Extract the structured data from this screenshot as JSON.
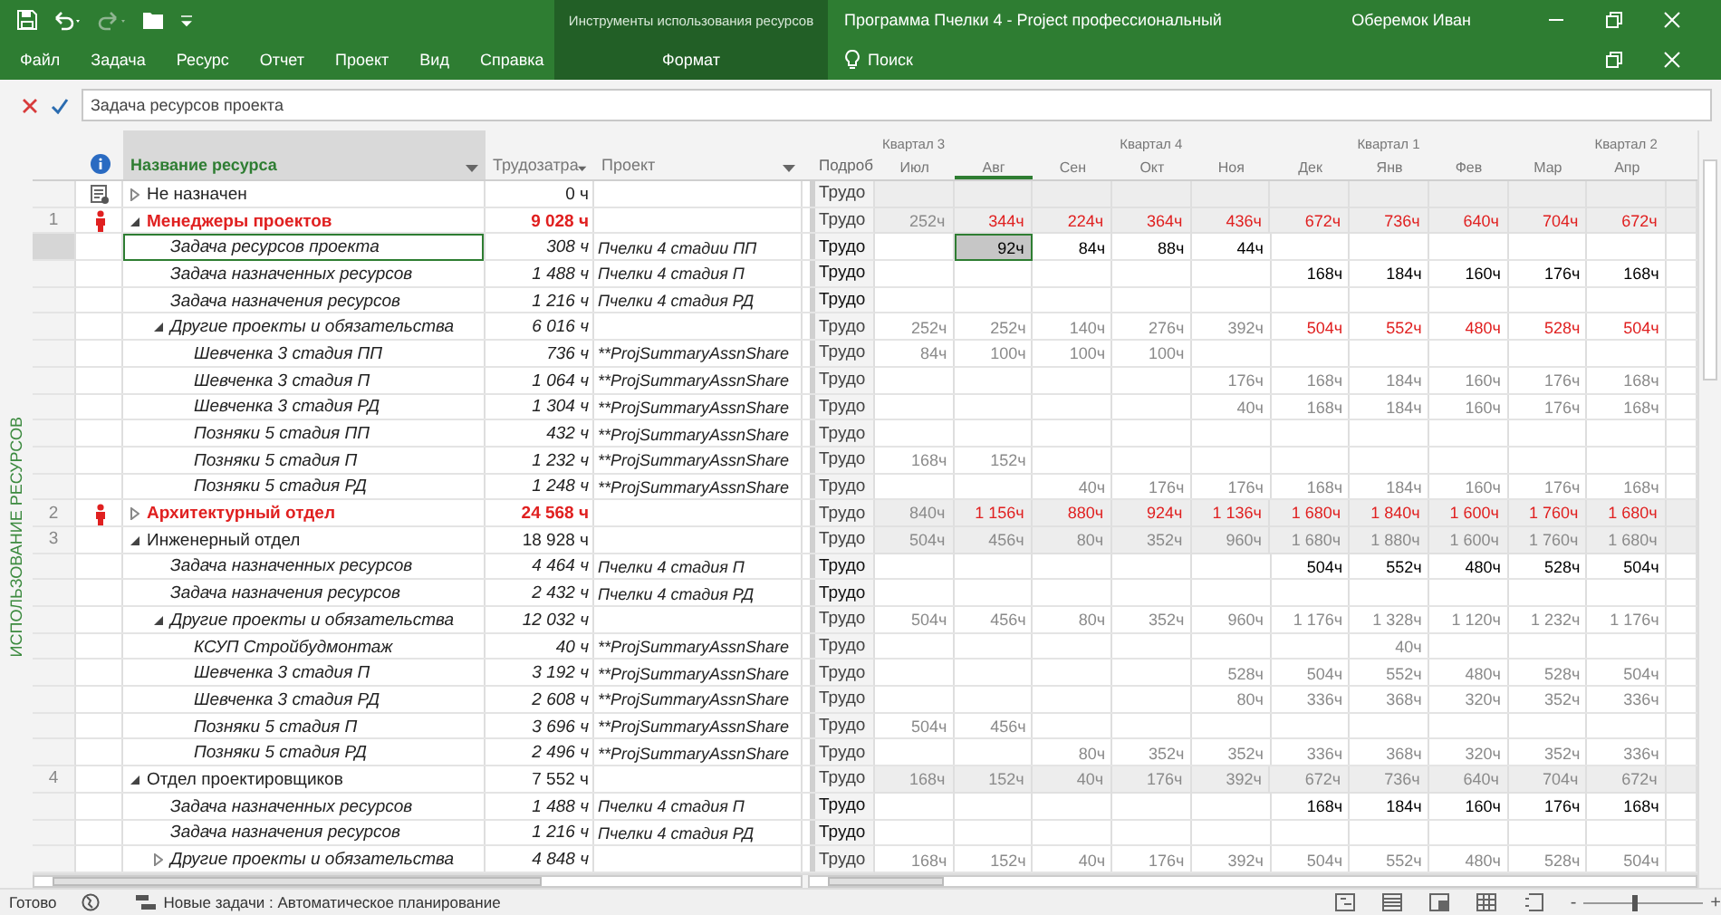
{
  "title_bar": {
    "contextual_group": "Инструменты использования ресурсов",
    "title": "Программа Пчелки 4  -  Project профессиональный",
    "user": "Оберемок Иван"
  },
  "ribbon_tabs": [
    {
      "label": "Файл",
      "contextual": false
    },
    {
      "label": "Задача",
      "contextual": false
    },
    {
      "label": "Ресурс",
      "contextual": false
    },
    {
      "label": "Отчет",
      "contextual": false
    },
    {
      "label": "Проект",
      "contextual": false
    },
    {
      "label": "Вид",
      "contextual": false
    },
    {
      "label": "Справка",
      "contextual": false
    },
    {
      "label": "Формат",
      "contextual": true
    }
  ],
  "search": "Поиск",
  "formula_bar": {
    "value": "Задача ресурсов проекта"
  },
  "view_label": "ИСПОЛЬЗОВАНИЕ РЕСУРСОВ",
  "columns": [
    {
      "label": "Название ресурса",
      "selected": true
    },
    {
      "label": "Трудозатра",
      "selected": false
    },
    {
      "label": "Проект",
      "selected": false
    }
  ],
  "timescale": {
    "detail_header": "Подроб",
    "quarters": [
      {
        "label": "Квартал 3",
        "months": [
          {
            "label": "Июл",
            "selected": false
          },
          {
            "label": "Авг",
            "selected": true
          },
          {
            "label": "Сен",
            "selected": false
          }
        ]
      },
      {
        "label": "Квартал 4",
        "months": [
          {
            "label": "Окт",
            "selected": false
          },
          {
            "label": "Ноя",
            "selected": false
          },
          {
            "label": "Дек",
            "selected": false
          }
        ]
      },
      {
        "label": "Квартал 1",
        "months": [
          {
            "label": "Янв",
            "selected": false
          },
          {
            "label": "Фев",
            "selected": false
          },
          {
            "label": "Мар",
            "selected": false
          }
        ]
      },
      {
        "label": "Квартал 2",
        "months": [
          {
            "label": "Апр",
            "selected": false
          }
        ]
      }
    ]
  },
  "resources": [
    {
      "kind": "unassigned",
      "name": "Не назначен",
      "work": "0 ч",
      "overallocated": false,
      "expanded": false,
      "selected": false,
      "detail": "Трудо",
      "cells": [
        null,
        null,
        null,
        null,
        null,
        null,
        null,
        null,
        null,
        null
      ]
    },
    {
      "number": "1",
      "kind": "resource",
      "name": "Менеджеры проектов",
      "work": "9 028 ч",
      "overallocated": true,
      "expanded": true,
      "selected": false,
      "detail": "Трудо",
      "cells": [
        {
          "text": "252ч",
          "overallocated": false
        },
        {
          "text": "344ч",
          "overallocated": true
        },
        {
          "text": "224ч",
          "overallocated": true
        },
        {
          "text": "364ч",
          "overallocated": true
        },
        {
          "text": "436ч",
          "overallocated": true
        },
        {
          "text": "672ч",
          "overallocated": true
        },
        {
          "text": "736ч",
          "overallocated": true
        },
        {
          "text": "640ч",
          "overallocated": true
        },
        {
          "text": "704ч",
          "overallocated": true
        },
        {
          "text": "672ч",
          "overallocated": true
        }
      ],
      "children": [
        {
          "name": "Задача ресурсов проекта",
          "work": "308 ч",
          "project": "Пчелки 4 стадии ПП",
          "editable": true,
          "selected": true,
          "detail": "Трудо",
          "cells": [
            null,
            {
              "text": "92ч",
              "overallocated": false
            },
            {
              "text": "84ч",
              "overallocated": false
            },
            {
              "text": "88ч",
              "overallocated": false
            },
            {
              "text": "44ч",
              "overallocated": false
            },
            null,
            null,
            null,
            null,
            null
          ]
        },
        {
          "name": "Задача назначенных ресурсов",
          "work": "1 488 ч",
          "project": "Пчелки 4 стадия П",
          "editable": true,
          "selected": false,
          "detail": "Трудо",
          "cells": [
            null,
            null,
            null,
            null,
            null,
            {
              "text": "168ч",
              "overallocated": false
            },
            {
              "text": "184ч",
              "overallocated": false
            },
            {
              "text": "160ч",
              "overallocated": false
            },
            {
              "text": "176ч",
              "overallocated": false
            },
            {
              "text": "168ч",
              "overallocated": false
            }
          ]
        },
        {
          "name": "Задача назначения ресурсов",
          "work": "1 216 ч",
          "project": "Пчелки 4 стадия РД",
          "editable": true,
          "selected": false,
          "detail": "Трудо",
          "cells": [
            null,
            null,
            null,
            null,
            null,
            null,
            null,
            null,
            null,
            null
          ]
        },
        {
          "name": "Другие проекты и обязательства",
          "work": "6 016 ч",
          "expanded": true,
          "editable": false,
          "selected": false,
          "detail": "Трудо",
          "cells": [
            {
              "text": "252ч",
              "overallocated": false
            },
            {
              "text": "252ч",
              "overallocated": false
            },
            {
              "text": "140ч",
              "overallocated": false
            },
            {
              "text": "276ч",
              "overallocated": false
            },
            {
              "text": "392ч",
              "overallocated": false
            },
            {
              "text": "504ч",
              "overallocated": true
            },
            {
              "text": "552ч",
              "overallocated": true
            },
            {
              "text": "480ч",
              "overallocated": true
            },
            {
              "text": "528ч",
              "overallocated": true
            },
            {
              "text": "504ч",
              "overallocated": true
            }
          ],
          "children": [
            {
              "name": "Шевченка 3 стадия ПП",
              "work": "736 ч",
              "project": "**ProjSummaryAssnShare",
              "editable": false,
              "selected": false,
              "detail": "Трудо",
              "cells": [
                {
                  "text": "84ч",
                  "overallocated": false
                },
                {
                  "text": "100ч",
                  "overallocated": false
                },
                {
                  "text": "100ч",
                  "overallocated": false
                },
                {
                  "text": "100ч",
                  "overallocated": false
                },
                null,
                null,
                null,
                null,
                null,
                null
              ]
            },
            {
              "name": "Шевченка 3 стадия П",
              "work": "1 064 ч",
              "project": "**ProjSummaryAssnShare",
              "editable": false,
              "selected": false,
              "detail": "Трудо",
              "cells": [
                null,
                null,
                null,
                null,
                {
                  "text": "176ч",
                  "overallocated": false
                },
                {
                  "text": "168ч",
                  "overallocated": false
                },
                {
                  "text": "184ч",
                  "overallocated": false
                },
                {
                  "text": "160ч",
                  "overallocated": false
                },
                {
                  "text": "176ч",
                  "overallocated": false
                },
                {
                  "text": "168ч",
                  "overallocated": false
                }
              ]
            },
            {
              "name": "Шевченка 3 стадия РД",
              "work": "1 304 ч",
              "project": "**ProjSummaryAssnShare",
              "editable": false,
              "selected": false,
              "detail": "Трудо",
              "cells": [
                null,
                null,
                null,
                null,
                {
                  "text": "40ч",
                  "overallocated": false
                },
                {
                  "text": "168ч",
                  "overallocated": false
                },
                {
                  "text": "184ч",
                  "overallocated": false
                },
                {
                  "text": "160ч",
                  "overallocated": false
                },
                {
                  "text": "176ч",
                  "overallocated": false
                },
                {
                  "text": "168ч",
                  "overallocated": false
                }
              ]
            },
            {
              "name": "Позняки 5 стадия ПП",
              "work": "432 ч",
              "project": "**ProjSummaryAssnShare",
              "editable": false,
              "selected": false,
              "detail": "Трудо",
              "cells": [
                null,
                null,
                null,
                null,
                null,
                null,
                null,
                null,
                null,
                null
              ]
            },
            {
              "name": "Позняки 5 стадия П",
              "work": "1 232 ч",
              "project": "**ProjSummaryAssnShare",
              "editable": false,
              "selected": false,
              "detail": "Трудо",
              "cells": [
                {
                  "text": "168ч",
                  "overallocated": false
                },
                {
                  "text": "152ч",
                  "overallocated": false
                },
                null,
                null,
                null,
                null,
                null,
                null,
                null,
                null
              ]
            },
            {
              "name": "Позняки 5 стадия РД",
              "work": "1 248 ч",
              "project": "**ProjSummaryAssnShare",
              "editable": false,
              "selected": false,
              "detail": "Трудо",
              "cells": [
                null,
                null,
                {
                  "text": "40ч",
                  "overallocated": false
                },
                {
                  "text": "176ч",
                  "overallocated": false
                },
                {
                  "text": "176ч",
                  "overallocated": false
                },
                {
                  "text": "168ч",
                  "overallocated": false
                },
                {
                  "text": "184ч",
                  "overallocated": false
                },
                {
                  "text": "160ч",
                  "overallocated": false
                },
                {
                  "text": "176ч",
                  "overallocated": false
                },
                {
                  "text": "168ч",
                  "overallocated": false
                }
              ]
            }
          ]
        }
      ]
    },
    {
      "number": "2",
      "kind": "resource",
      "name": "Архитектурный отдел",
      "work": "24 568 ч",
      "overallocated": true,
      "expanded": false,
      "selected": false,
      "detail": "Трудо",
      "cells": [
        {
          "text": "840ч",
          "overallocated": false
        },
        {
          "text": "1 156ч",
          "overallocated": true
        },
        {
          "text": "880ч",
          "overallocated": true
        },
        {
          "text": "924ч",
          "overallocated": true
        },
        {
          "text": "1 136ч",
          "overallocated": true
        },
        {
          "text": "1 680ч",
          "overallocated": true
        },
        {
          "text": "1 840ч",
          "overallocated": true
        },
        {
          "text": "1 600ч",
          "overallocated": true
        },
        {
          "text": "1 760ч",
          "overallocated": true
        },
        {
          "text": "1 680ч",
          "overallocated": true
        }
      ]
    },
    {
      "number": "3",
      "kind": "resource",
      "name": "Инженерный отдел",
      "work": "18 928 ч",
      "overallocated": false,
      "expanded": true,
      "selected": false,
      "detail": "Трудо",
      "cells": [
        {
          "text": "504ч",
          "overallocated": false
        },
        {
          "text": "456ч",
          "overallocated": false
        },
        {
          "text": "80ч",
          "overallocated": false
        },
        {
          "text": "352ч",
          "overallocated": false
        },
        {
          "text": "960ч",
          "overallocated": false
        },
        {
          "text": "1 680ч",
          "overallocated": false
        },
        {
          "text": "1 880ч",
          "overallocated": false
        },
        {
          "text": "1 600ч",
          "overallocated": false
        },
        {
          "text": "1 760ч",
          "overallocated": false
        },
        {
          "text": "1 680ч",
          "overallocated": false
        }
      ],
      "children": [
        {
          "name": "Задача назначенных ресурсов",
          "work": "4 464 ч",
          "project": "Пчелки 4 стадия П",
          "editable": true,
          "selected": false,
          "detail": "Трудо",
          "cells": [
            null,
            null,
            null,
            null,
            null,
            {
              "text": "504ч",
              "overallocated": false
            },
            {
              "text": "552ч",
              "overallocated": false
            },
            {
              "text": "480ч",
              "overallocated": false
            },
            {
              "text": "528ч",
              "overallocated": false
            },
            {
              "text": "504ч",
              "overallocated": false
            }
          ]
        },
        {
          "name": "Задача назначения ресурсов",
          "work": "2 432 ч",
          "project": "Пчелки 4 стадия РД",
          "editable": true,
          "selected": false,
          "detail": "Трудо",
          "cells": [
            null,
            null,
            null,
            null,
            null,
            null,
            null,
            null,
            null,
            null
          ]
        },
        {
          "name": "Другие проекты и обязательства",
          "work": "12 032 ч",
          "expanded": true,
          "editable": false,
          "selected": false,
          "detail": "Трудо",
          "cells": [
            {
              "text": "504ч",
              "overallocated": false
            },
            {
              "text": "456ч",
              "overallocated": false
            },
            {
              "text": "80ч",
              "overallocated": false
            },
            {
              "text": "352ч",
              "overallocated": false
            },
            {
              "text": "960ч",
              "overallocated": false
            },
            {
              "text": "1 176ч",
              "overallocated": false
            },
            {
              "text": "1 328ч",
              "overallocated": false
            },
            {
              "text": "1 120ч",
              "overallocated": false
            },
            {
              "text": "1 232ч",
              "overallocated": false
            },
            {
              "text": "1 176ч",
              "overallocated": false
            }
          ],
          "children": [
            {
              "name": "КСУП Стройбудмонтаж",
              "work": "40 ч",
              "project": "**ProjSummaryAssnShare",
              "editable": false,
              "selected": false,
              "detail": "Трудо",
              "cells": [
                null,
                null,
                null,
                null,
                null,
                null,
                {
                  "text": "40ч",
                  "overallocated": false
                },
                null,
                null,
                null
              ]
            },
            {
              "name": "Шевченка 3 стадия П",
              "work": "3 192 ч",
              "project": "**ProjSummaryAssnShare",
              "editable": false,
              "selected": false,
              "detail": "Трудо",
              "cells": [
                null,
                null,
                null,
                null,
                {
                  "text": "528ч",
                  "overallocated": false
                },
                {
                  "text": "504ч",
                  "overallocated": false
                },
                {
                  "text": "552ч",
                  "overallocated": false
                },
                {
                  "text": "480ч",
                  "overallocated": false
                },
                {
                  "text": "528ч",
                  "overallocated": false
                },
                {
                  "text": "504ч",
                  "overallocated": false
                }
              ]
            },
            {
              "name": "Шевченка 3 стадия РД",
              "work": "2 608 ч",
              "project": "**ProjSummaryAssnShare",
              "editable": false,
              "selected": false,
              "detail": "Трудо",
              "cells": [
                null,
                null,
                null,
                null,
                {
                  "text": "80ч",
                  "overallocated": false
                },
                {
                  "text": "336ч",
                  "overallocated": false
                },
                {
                  "text": "368ч",
                  "overallocated": false
                },
                {
                  "text": "320ч",
                  "overallocated": false
                },
                {
                  "text": "352ч",
                  "overallocated": false
                },
                {
                  "text": "336ч",
                  "overallocated": false
                }
              ]
            },
            {
              "name": "Позняки 5 стадия П",
              "work": "3 696 ч",
              "project": "**ProjSummaryAssnShare",
              "editable": false,
              "selected": false,
              "detail": "Трудо",
              "cells": [
                {
                  "text": "504ч",
                  "overallocated": false
                },
                {
                  "text": "456ч",
                  "overallocated": false
                },
                null,
                null,
                null,
                null,
                null,
                null,
                null,
                null
              ]
            },
            {
              "name": "Позняки 5 стадия РД",
              "work": "2 496 ч",
              "project": "**ProjSummaryAssnShare",
              "editable": false,
              "selected": false,
              "detail": "Трудо",
              "cells": [
                null,
                null,
                {
                  "text": "80ч",
                  "overallocated": false
                },
                {
                  "text": "352ч",
                  "overallocated": false
                },
                {
                  "text": "352ч",
                  "overallocated": false
                },
                {
                  "text": "336ч",
                  "overallocated": false
                },
                {
                  "text": "368ч",
                  "overallocated": false
                },
                {
                  "text": "320ч",
                  "overallocated": false
                },
                {
                  "text": "352ч",
                  "overallocated": false
                },
                {
                  "text": "336ч",
                  "overallocated": false
                }
              ]
            }
          ]
        }
      ]
    },
    {
      "number": "4",
      "kind": "resource",
      "name": "Отдел проектировщиков",
      "work": "7 552 ч",
      "overallocated": false,
      "expanded": true,
      "selected": false,
      "detail": "Трудо",
      "cells": [
        {
          "text": "168ч",
          "overallocated": false
        },
        {
          "text": "152ч",
          "overallocated": false
        },
        {
          "text": "40ч",
          "overallocated": false
        },
        {
          "text": "176ч",
          "overallocated": false
        },
        {
          "text": "392ч",
          "overallocated": false
        },
        {
          "text": "672ч",
          "overallocated": false
        },
        {
          "text": "736ч",
          "overallocated": false
        },
        {
          "text": "640ч",
          "overallocated": false
        },
        {
          "text": "704ч",
          "overallocated": false
        },
        {
          "text": "672ч",
          "overallocated": false
        }
      ],
      "children": [
        {
          "name": "Задача назначенных ресурсов",
          "work": "1 488 ч",
          "project": "Пчелки 4 стадия П",
          "editable": true,
          "selected": false,
          "detail": "Трудо",
          "cells": [
            null,
            null,
            null,
            null,
            null,
            {
              "text": "168ч",
              "overallocated": false
            },
            {
              "text": "184ч",
              "overallocated": false
            },
            {
              "text": "160ч",
              "overallocated": false
            },
            {
              "text": "176ч",
              "overallocated": false
            },
            {
              "text": "168ч",
              "overallocated": false
            }
          ]
        },
        {
          "name": "Задача назначения ресурсов",
          "work": "1 216 ч",
          "project": "Пчелки 4 стадия РД",
          "editable": true,
          "selected": false,
          "detail": "Трудо",
          "cells": [
            null,
            null,
            null,
            null,
            null,
            null,
            null,
            null,
            null,
            null
          ]
        },
        {
          "name": "Другие проекты и обязательства",
          "work": "4 848 ч",
          "expanded": false,
          "editable": false,
          "selected": false,
          "detail": "Трудо",
          "cells": [
            {
              "text": "168ч",
              "overallocated": false
            },
            {
              "text": "152ч",
              "overallocated": false
            },
            {
              "text": "40ч",
              "overallocated": false
            },
            {
              "text": "176ч",
              "overallocated": false
            },
            {
              "text": "392ч",
              "overallocated": false
            },
            {
              "text": "504ч",
              "overallocated": false
            },
            {
              "text": "552ч",
              "overallocated": false
            },
            {
              "text": "480ч",
              "overallocated": false
            },
            {
              "text": "528ч",
              "overallocated": false
            },
            {
              "text": "504ч",
              "overallocated": false
            }
          ]
        }
      ]
    }
  ],
  "status_bar": {
    "ready": "Готово",
    "task_mode": "Новые задачи : Автоматическое планирование",
    "zoom": {
      "minus": "-",
      "plus": "+",
      "level": 0.45
    }
  }
}
